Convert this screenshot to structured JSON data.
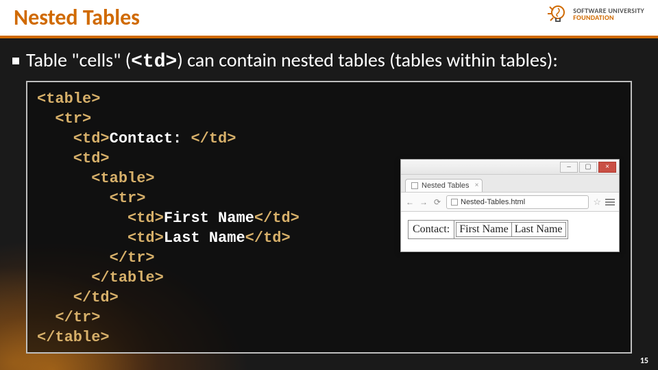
{
  "title": "Nested Tables",
  "logo": {
    "line1": "SOFTWARE UNIVERSITY",
    "line2": "FOUNDATION"
  },
  "bullet": {
    "prefix": "Table \"cells\" (",
    "tag": "<td>",
    "suffix": ") can contain nested tables (tables within tables):"
  },
  "code": {
    "l1": "<table>",
    "l2": "  <tr>",
    "l3a": "    <td>",
    "l3b": "Contact: ",
    "l3c": "</td>",
    "l4": "    <td>",
    "l5": "      <table>",
    "l6": "        <tr>",
    "l7a": "          <td>",
    "l7b": "First Name",
    "l7c": "</td>",
    "l8a": "          <td>",
    "l8b": "Last Name",
    "l8c": "</td>",
    "l9": "        </tr>",
    "l10": "      </table>",
    "l11": "    </td>",
    "l12": "  </tr>",
    "l13": "</table>"
  },
  "browser": {
    "tab_title": "Nested Tables",
    "url": "Nested-Tables.html",
    "window": {
      "min": "–",
      "max": "▢",
      "close": "×"
    },
    "nav": {
      "back": "←",
      "fwd": "→",
      "reload": "⟳"
    },
    "star": "☆",
    "tab_close": "×",
    "table": {
      "outer_label": "Contact:",
      "inner_c1": "First Name",
      "inner_c2": "Last Name"
    }
  },
  "page_number": "15"
}
